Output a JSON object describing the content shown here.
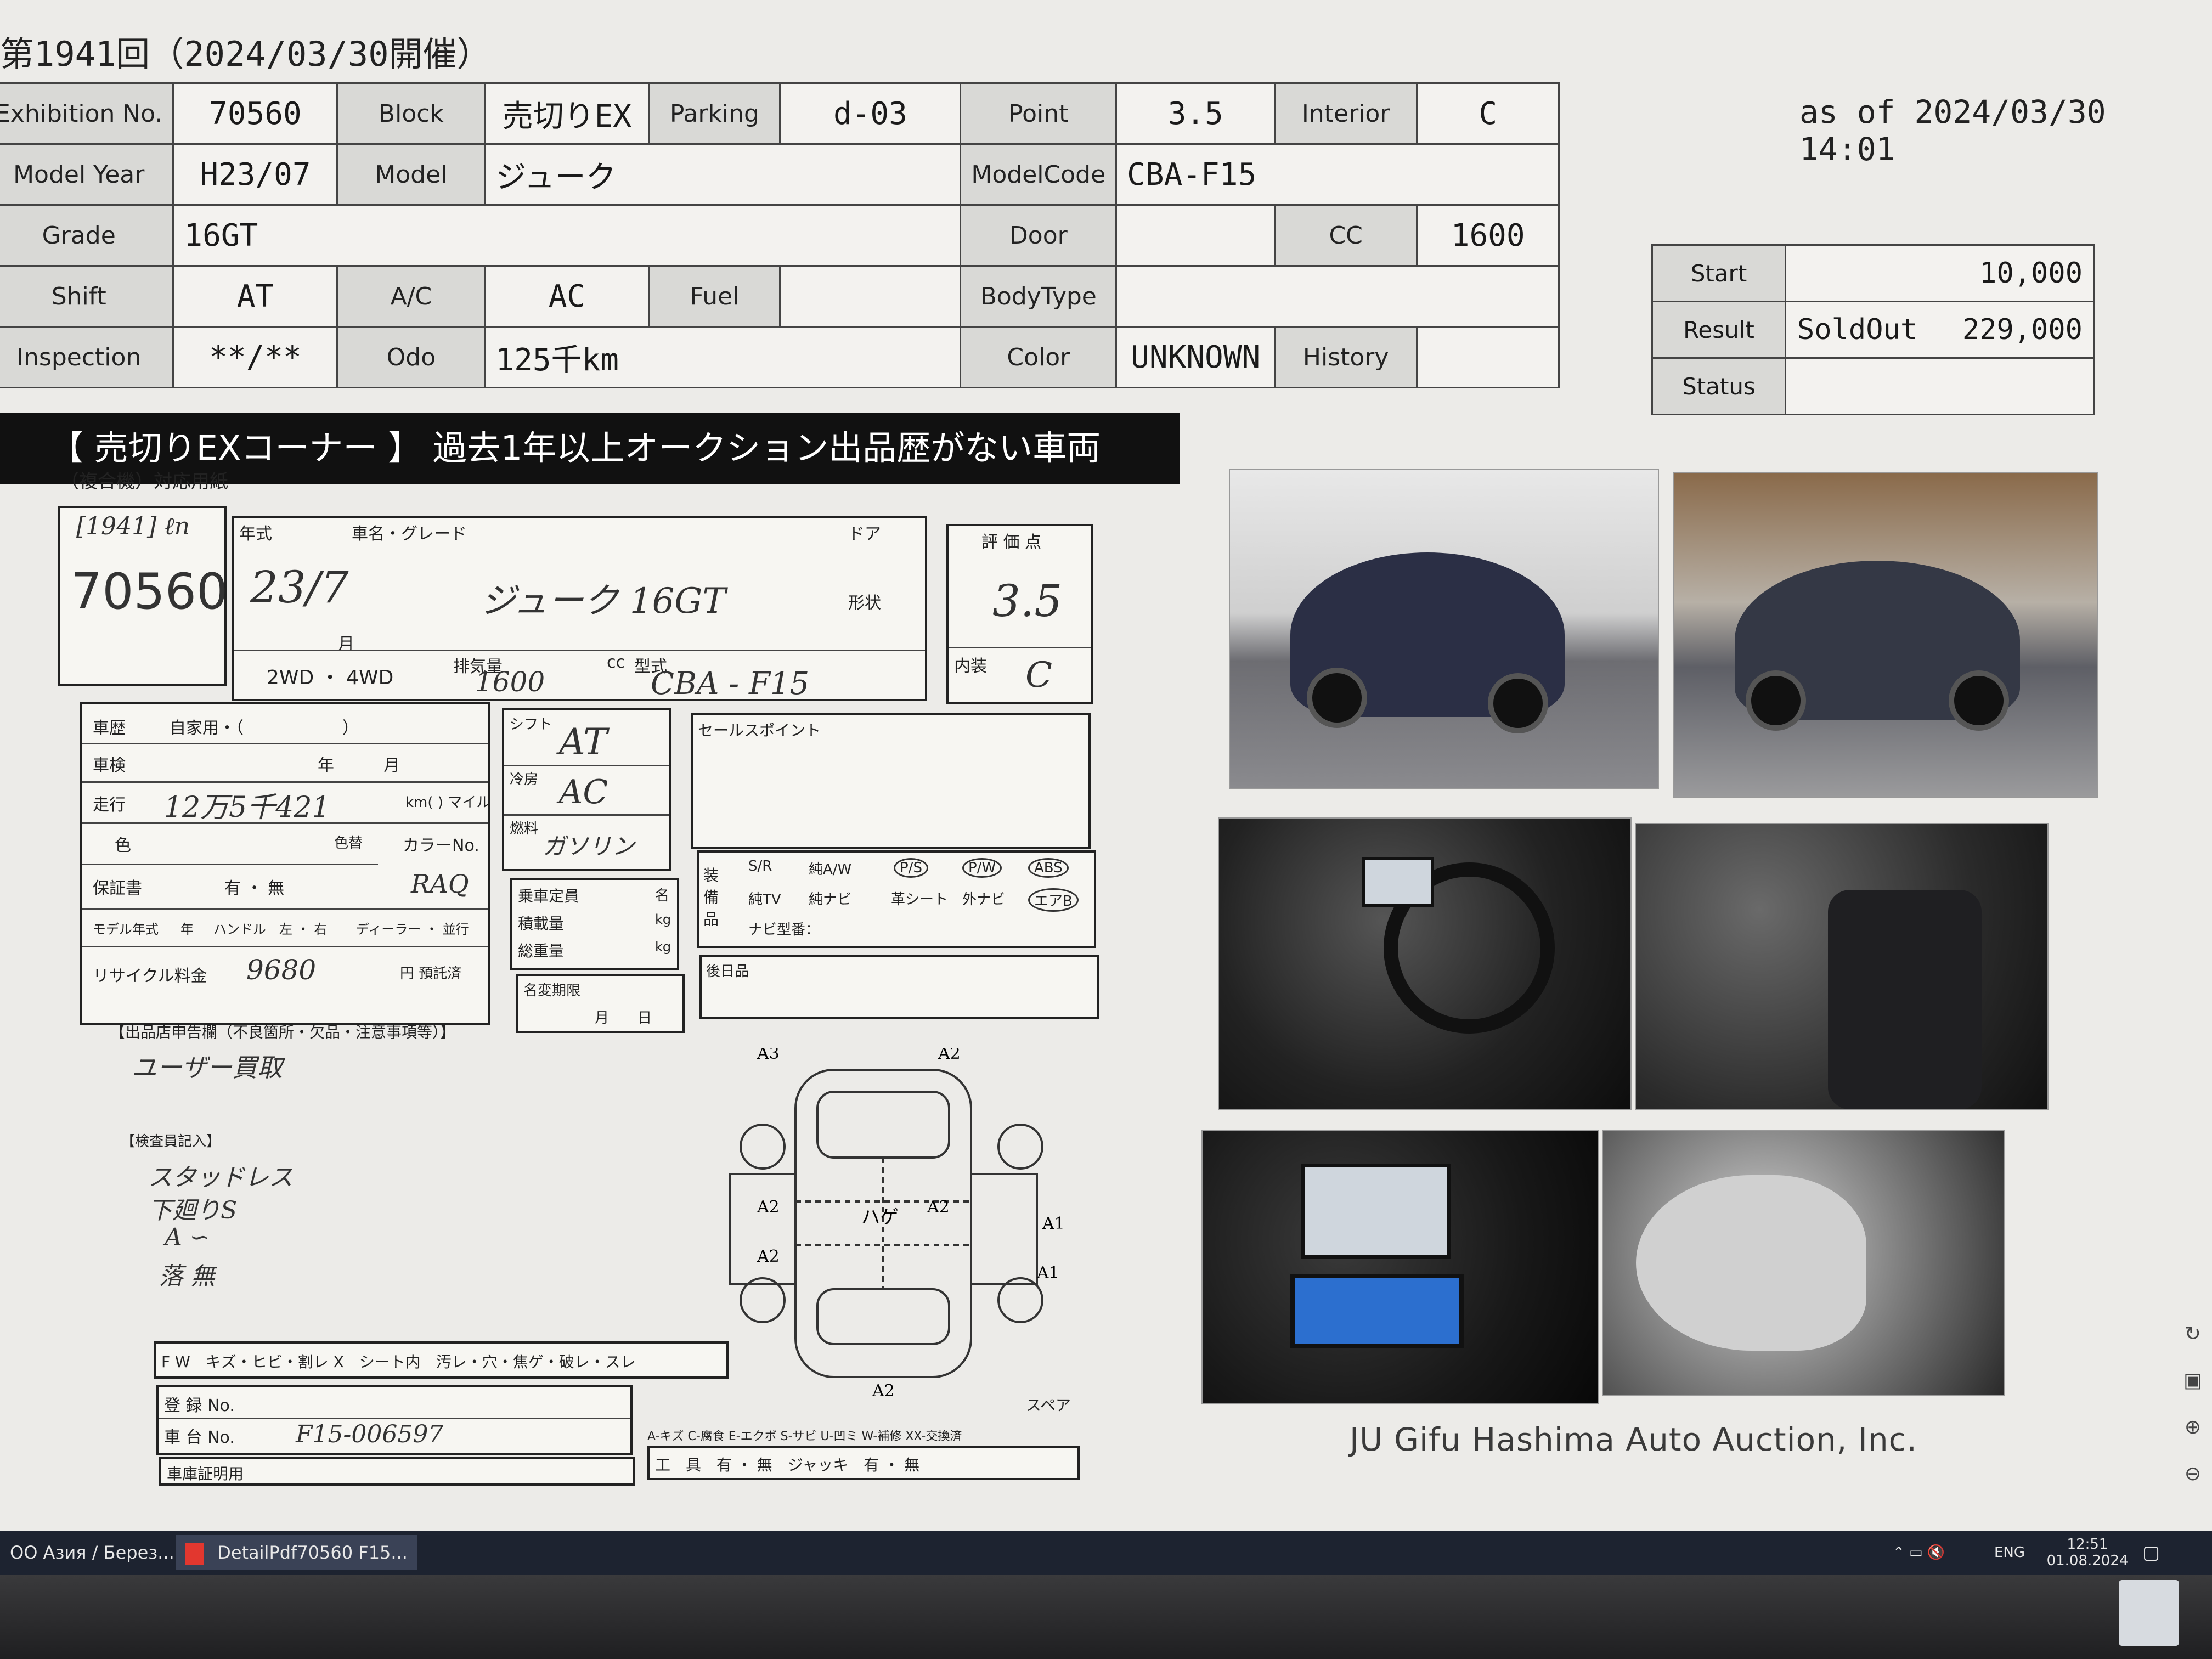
{
  "header": {
    "title": "第1941回（2024/03/30開催）",
    "as_of": "as of 2024/03/30 14:01"
  },
  "spec": {
    "exhibition_label": "Exhibition No.",
    "exhibition_no": "70560",
    "block_label": "Block",
    "block": "売切りEX",
    "parking_label": "Parking",
    "parking": "d-03",
    "point_label": "Point",
    "point": "3.5",
    "interior_label": "Interior",
    "interior": "C",
    "model_year_label": "Model Year",
    "model_year": "H23/07",
    "model_label": "Model",
    "model": "ジューク",
    "modelcode_label": "ModelCode",
    "modelcode": "CBA-F15",
    "grade_label": "Grade",
    "grade": "16GT",
    "door_label": "Door",
    "door": "",
    "cc_label": "CC",
    "cc": "1600",
    "shift_label": "Shift",
    "shift": "AT",
    "ac_label": "A/C",
    "ac": "AC",
    "fuel_label": "Fuel",
    "fuel": "",
    "bodytype_label": "BodyType",
    "bodytype": "",
    "inspection_label": "Inspection",
    "inspection": "**/**",
    "odo_label": "Odo",
    "odo": "125千km",
    "color_label": "Color",
    "color": "UNKNOWN",
    "history_label": "History",
    "history": ""
  },
  "price": {
    "start_label": "Start",
    "start": "10,000",
    "result_label": "Result",
    "result_status": "SoldOut",
    "result_value": "229,000",
    "status_label": "Status",
    "status": ""
  },
  "banner": {
    "text": "【 売切りEXコーナー 】 過去1年以上オークション出品歴がない車両",
    "note": "（複合機）対応用紙"
  },
  "sheet": {
    "lot_hand": "70560",
    "lot_tag": "[1941] ℓn",
    "nenshiki_label": "年式",
    "year_hand": "23/7",
    "month_label": "月",
    "name_grade_label": "車名・グレード",
    "name_grade_hand": "ジューク 16GT",
    "door_label": "ドア",
    "shape_label": "形状",
    "drive_label": "2WD ・ 4WD",
    "displacement_label": "排気量",
    "displacement_hand": "1600",
    "cc_unit": "cc",
    "type_label": "型式",
    "type_hand": "CBA - F15",
    "score_label": "評 価 点",
    "score_hand": "3.5",
    "interior_label": "内装",
    "interior_hand": "C",
    "history_label": "車歴",
    "history_value": "自家用・（　　　　　　）",
    "shaken_label": "車検",
    "shaken_value": "年　　　月",
    "mileage_label": "走行",
    "mileage_hand": "12万5千421",
    "mileage_unit": "km(  ) マイル",
    "color_label": "色",
    "color_change_label": "色替",
    "color_no_label": "カラーNo.",
    "color_no_hand": "RAQ",
    "warranty_label": "保証書",
    "warranty_value": "有 ・ 無",
    "model_year_label": "モデル年式",
    "model_year_unit": "年",
    "handle_label": "ハンドル　左 ・ 右",
    "dealer_label": "ディーラー ・ 並行",
    "recycle_label": "リサイクル料金",
    "recycle_hand": "9680",
    "recycle_unit": "円 預託済",
    "shift_label": "シフト",
    "shift_hand": "AT",
    "aircon_label": "冷房",
    "aircon_hand": "AC",
    "fuel_label": "燃料",
    "fuel_hand": "ガソリン",
    "capacity_label": "乗車定員",
    "capacity_unit": "名",
    "load_label": "積載量",
    "load_unit": "kg",
    "gross_label": "総重量",
    "gross_unit": "kg",
    "name_change_label": "名変期限",
    "name_change_value": "月　　日",
    "sales_point_label": "セールスポイント",
    "equip_label": "装備品",
    "equip_items": [
      "S/R",
      "純A/W",
      "P/S",
      "P/W",
      "ABS",
      "純TV",
      "純ナビ",
      "革シート",
      "外ナビ",
      "エアB"
    ],
    "navi_label": "ナビ型番：",
    "later_label": "後日品",
    "declaration_label": "【出品店申告欄（不良箇所・欠品・注意事項等）】",
    "declaration_hand": "ユーザー買取",
    "inspector_label": "【検査員記入】",
    "inspector_lines": [
      "スタッドレス",
      "下廻りS",
      "A  ∽",
      "落 無"
    ],
    "spare_label": "スペア",
    "fw_label": "F W　キズ・ヒビ・割レ X　シート内　汚レ・穴・焦ゲ・破レ・スレ",
    "reg_no_label": "登 録 No.",
    "chassis_label": "車 台 No.",
    "chassis_hand": "F15-006597",
    "cert_label": "車庫証明用",
    "legend": "A-キズ C-腐食 E-エクボ S-サビ U-凹ミ W-補修 XX-交換済",
    "tools_label": "工　具　有 ・ 無　ジャッキ　有 ・ 無",
    "diagram_marks": [
      "A3",
      "A2",
      "A2",
      "A2",
      "A2",
      "ハゲ",
      "A1",
      "A2",
      "A1",
      "A2"
    ]
  },
  "footer": "JU Gifu Hashima Auto Auction, Inc.",
  "taskbar": {
    "item1": "ОО Азия / Берез...",
    "item2": "DetailPdf70560 F15...",
    "lang": "ENG",
    "time": "12:51",
    "date": "01.08.2024"
  }
}
